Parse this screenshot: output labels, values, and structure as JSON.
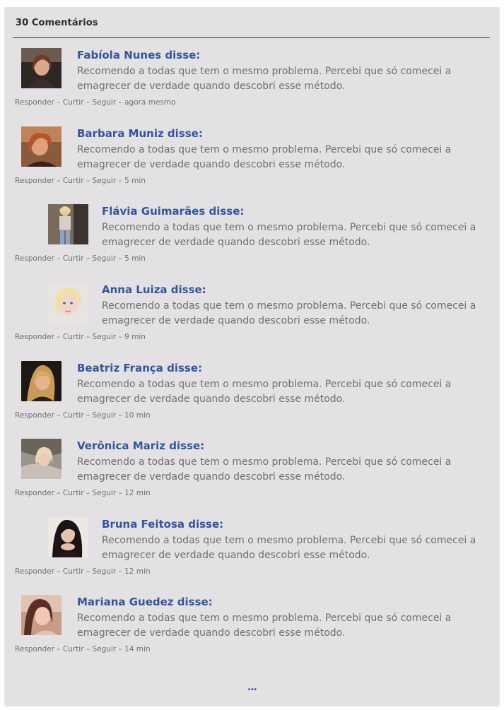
{
  "header": {
    "title": "30 Comentários"
  },
  "actions": {
    "reply": "Responder",
    "like": "Curtir",
    "follow": "Seguir",
    "sep": " – "
  },
  "comments": [
    {
      "author": "Fabíola Nunes disse:",
      "text": "Recomendo a todas que tem o mesmo problema. Percebi que só comecei a emagrecer de verdade quando descobri esse método.",
      "time": "agora mesmo"
    },
    {
      "author": "Barbara Muniz disse:",
      "text": "Recomendo a todas que tem o mesmo problema. Percebi que só comecei a emagrecer de verdade quando descobri esse método.",
      "time": "5 min"
    },
    {
      "author": "Flávia Guimarães disse:",
      "text": "Recomendo a todas que tem o mesmo problema. Percebi que só comecei a emagrecer de verdade quando descobri esse método.",
      "time": "5 min"
    },
    {
      "author": "Anna Luiza disse:",
      "text": "Recomendo a todas que tem o mesmo problema. Percebi que só comecei a emagrecer de verdade quando descobri esse método.",
      "time": "9 min"
    },
    {
      "author": "Beatriz França disse:",
      "text": "Recomendo a todas que tem o mesmo problema. Percebi que só comecei a emagrecer de verdade quando descobri esse método.",
      "time": "10 min"
    },
    {
      "author": "Verônica Mariz disse:",
      "text": "Recomendo a todas que tem o mesmo problema. Percebi que só comecei a emagrecer de verdade quando descobri esse método.",
      "time": "12 min"
    },
    {
      "author": "Bruna Feitosa disse:",
      "text": "Recomendo a todas que tem o mesmo problema. Percebi que só comecei a emagrecer de verdade quando descobri esse método.",
      "time": "12 min"
    },
    {
      "author": "Mariana Guedez disse:",
      "text": "Recomendo a todas que tem o mesmo problema. Percebi que só comecei a emagrecer de verdade quando descobri esse método.",
      "time": "14 min"
    }
  ],
  "more": {
    "label": "..."
  },
  "colors": {
    "panel": "#e3e1e4",
    "name": "#34559a",
    "text": "#6f6f72"
  }
}
